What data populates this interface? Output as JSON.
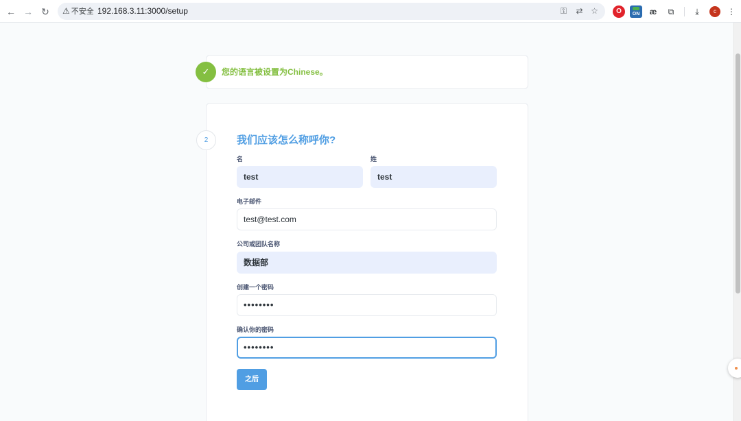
{
  "browser": {
    "security_label": "不安全",
    "url": "192.168.3.11:3000/setup",
    "profile_initial": "c",
    "extension_on_label": "ON",
    "icons": [
      "back-icon",
      "forward-icon",
      "reload-icon",
      "warning-icon",
      "key-icon",
      "translate-icon",
      "star-icon",
      "opera-icon",
      "ae-icon",
      "extensions-icon",
      "download-icon",
      "menu-icon"
    ]
  },
  "language_step": {
    "message": "您的语言被设置为Chinese。"
  },
  "user_step": {
    "step_number": "2",
    "title": "我们应该怎么称呼你?",
    "first_name": {
      "label": "名",
      "value": "test"
    },
    "last_name": {
      "label": "姓",
      "value": "test"
    },
    "email": {
      "label": "电子邮件",
      "value": "test@test.com"
    },
    "company": {
      "label": "公司或团队名称",
      "value": "数据部"
    },
    "password": {
      "label": "创建一个密码",
      "value": "••••••••"
    },
    "confirm_password": {
      "label": "确认你的密码",
      "value": "••••••••"
    },
    "next_label": "之后"
  },
  "colors": {
    "accent": "#509ee3",
    "success": "#84bf41",
    "filled_input": "#e9effd"
  }
}
